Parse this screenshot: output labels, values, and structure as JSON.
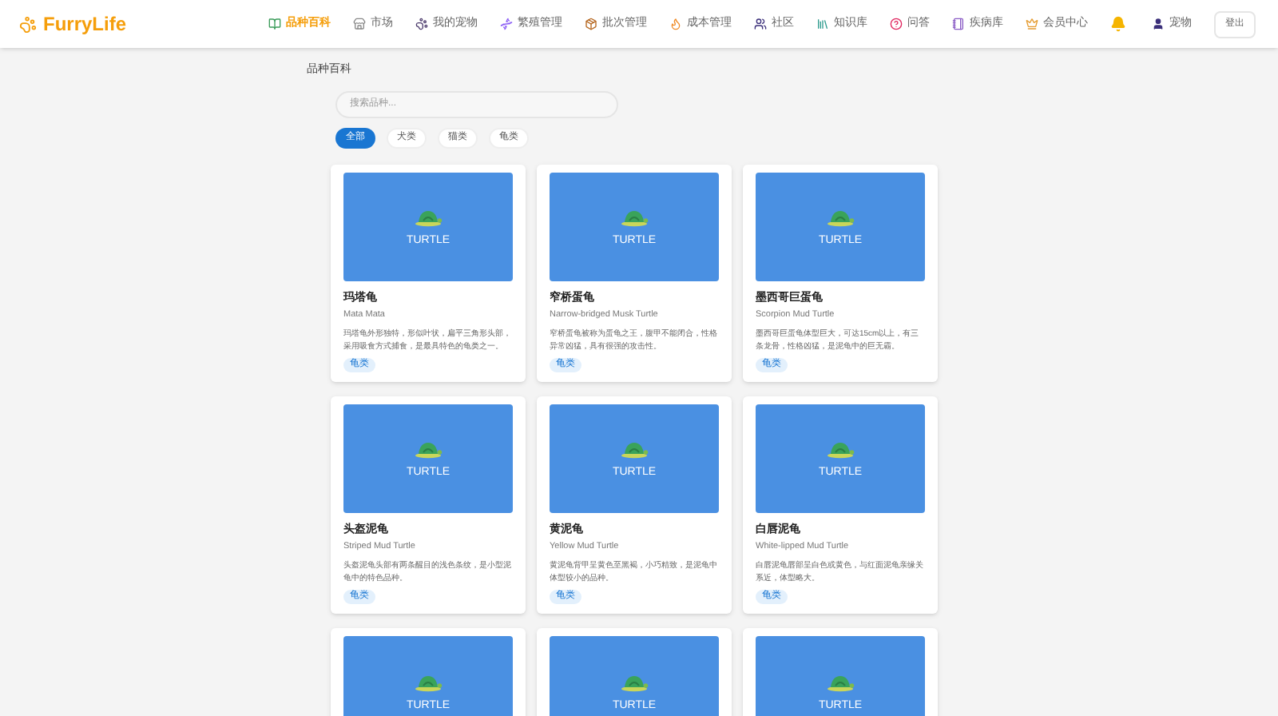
{
  "brand": "FurryLife",
  "nav": [
    {
      "label": "品种百科",
      "selected": true
    },
    {
      "label": "市场",
      "selected": false
    },
    {
      "label": "我的宠物",
      "selected": false
    },
    {
      "label": "繁殖管理",
      "selected": false
    },
    {
      "label": "批次管理",
      "selected": false
    },
    {
      "label": "成本管理",
      "selected": false
    },
    {
      "label": "社区",
      "selected": false
    },
    {
      "label": "知识库",
      "selected": false
    },
    {
      "label": "问答",
      "selected": false
    },
    {
      "label": "疾病库",
      "selected": false
    },
    {
      "label": "会员中心",
      "selected": false
    }
  ],
  "user": "宠物",
  "logout": "登出",
  "page_title": "品种百科",
  "search": {
    "placeholder": "搜索品种..."
  },
  "filters": [
    {
      "label": "全部",
      "selected": true
    },
    {
      "label": "犬类",
      "selected": false
    },
    {
      "label": "猫类",
      "selected": false
    },
    {
      "label": "龟类",
      "selected": false
    }
  ],
  "cards": [
    {
      "image_label": "TURTLE",
      "name": "玛塔龟",
      "latin": "Mata Mata",
      "desc": "玛塔龟外形独特，形似叶状，扁平三角形头部，采用吸食方式捕食，是最具特色的龟类之一。",
      "tag": "龟类"
    },
    {
      "image_label": "TURTLE",
      "name": "窄桥蛋龟",
      "latin": "Narrow-bridged Musk Turtle",
      "desc": "窄桥蛋龟被称为蛋龟之王，腹甲不能闭合，性格异常凶猛，具有很强的攻击性。",
      "tag": "龟类"
    },
    {
      "image_label": "TURTLE",
      "name": "墨西哥巨蛋龟",
      "latin": "Scorpion Mud Turtle",
      "desc": "墨西哥巨蛋龟体型巨大，可达15cm以上，有三条龙骨，性格凶猛，是泥龟中的巨无霸。",
      "tag": "龟类"
    },
    {
      "image_label": "TURTLE",
      "name": "头盔泥龟",
      "latin": "Striped Mud Turtle",
      "desc": "头盔泥龟头部有两条醒目的浅色条纹，是小型泥龟中的特色品种。",
      "tag": "龟类"
    },
    {
      "image_label": "TURTLE",
      "name": "黄泥龟",
      "latin": "Yellow Mud Turtle",
      "desc": "黄泥龟背甲呈黄色至黑褐，小巧精致，是泥龟中体型较小的品种。",
      "tag": "龟类"
    },
    {
      "image_label": "TURTLE",
      "name": "白唇泥龟",
      "latin": "White-lipped Mud Turtle",
      "desc": "白唇泥龟唇部呈白色或黄色，与红面泥龟亲缘关系近，体型略大。",
      "tag": "龟类"
    },
    {
      "image_label": "TURTLE"
    },
    {
      "image_label": "TURTLE"
    },
    {
      "image_label": "TURTLE"
    }
  ]
}
